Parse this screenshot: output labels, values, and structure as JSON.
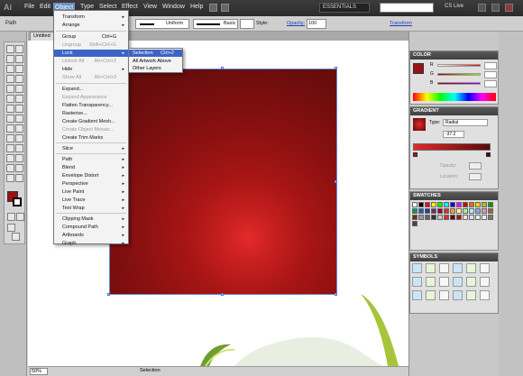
{
  "app": {
    "logo": "Ai"
  },
  "menubar": {
    "items": [
      "File",
      "Edit",
      "Object",
      "Type",
      "Select",
      "Effect",
      "View",
      "Window",
      "Help"
    ],
    "workspace": "ESSENTIALS",
    "cslive": "CS Live"
  },
  "control": {
    "selection_label": "Path",
    "stroke_profile": "Uniform",
    "brush": "Basic",
    "style_label": "Style:",
    "opacity_label": "Opacity:",
    "opacity_value": "100",
    "transform_label": "Transform"
  },
  "document": {
    "tab_title": "Untitled"
  },
  "object_menu": {
    "items": [
      {
        "label": "Transform",
        "arrow": true
      },
      {
        "label": "Arrange",
        "arrow": true
      },
      {
        "label": "Group",
        "shortcut": "Ctrl+G"
      },
      {
        "label": "Ungroup",
        "shortcut": "Shift+Ctrl+G",
        "disabled": true
      },
      {
        "label": "Lock",
        "arrow": true,
        "highlight": true
      },
      {
        "label": "Unlock All",
        "shortcut": "Alt+Ctrl+2",
        "disabled": true
      },
      {
        "label": "Hide",
        "arrow": true
      },
      {
        "label": "Show All",
        "shortcut": "Alt+Ctrl+3",
        "disabled": true
      },
      {
        "label": "Expand..."
      },
      {
        "label": "Expand Appearance",
        "disabled": true
      },
      {
        "label": "Flatten Transparency..."
      },
      {
        "label": "Rasterize..."
      },
      {
        "label": "Create Gradient Mesh..."
      },
      {
        "label": "Create Object Mosaic...",
        "disabled": true
      },
      {
        "label": "Create Trim Marks"
      },
      {
        "label": "Slice",
        "arrow": true
      },
      {
        "label": "Path",
        "arrow": true
      },
      {
        "label": "Blend",
        "arrow": true
      },
      {
        "label": "Envelope Distort",
        "arrow": true
      },
      {
        "label": "Perspective",
        "arrow": true
      },
      {
        "label": "Live Paint",
        "arrow": true
      },
      {
        "label": "Live Trace",
        "arrow": true
      },
      {
        "label": "Text Wrap",
        "arrow": true
      },
      {
        "label": "Clipping Mask",
        "arrow": true
      },
      {
        "label": "Compound Path",
        "arrow": true
      },
      {
        "label": "Artboards",
        "arrow": true
      },
      {
        "label": "Graph",
        "arrow": true
      }
    ]
  },
  "lock_submenu": {
    "items": [
      {
        "label": "Selection",
        "shortcut": "Ctrl+2",
        "highlight": true
      },
      {
        "label": "All Artwork Above"
      },
      {
        "label": "Other Layers"
      }
    ]
  },
  "panels": {
    "color": {
      "title": "COLOR",
      "channels": [
        "R",
        "G",
        "B"
      ]
    },
    "gradient": {
      "title": "GRADIENT",
      "type_label": "Type:",
      "type_value": "Radial",
      "angle": "-37.2",
      "opacity_label": "Opacity:",
      "location_label": "Location:"
    },
    "swatches": {
      "title": "SWATCHES"
    },
    "symbols": {
      "title": "SYMBOLS"
    }
  },
  "status": {
    "zoom": "50%",
    "tool": "Selection"
  },
  "colors": {
    "artwork_center": "#e42a2a",
    "artwork_edge": "#5c0a0a",
    "menu_highlight": "#3c64c6",
    "fill": "#9b1212"
  }
}
